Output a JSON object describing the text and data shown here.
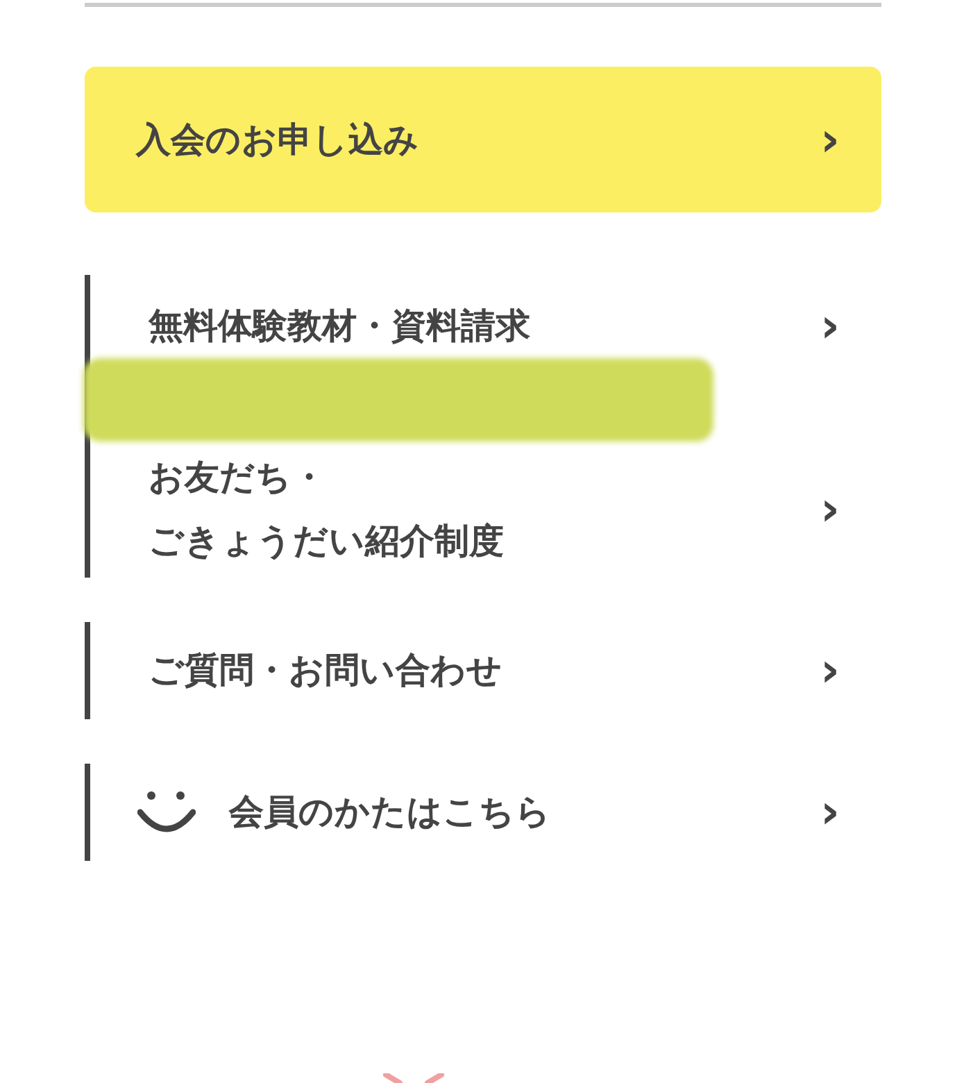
{
  "apply_button": {
    "label": "入会のお申し込み",
    "arrow": "›"
  },
  "menu_groups": [
    {
      "items": [
        {
          "lines": [
            "無料体験教材・資料請求"
          ],
          "arrow": "›",
          "kind": "text"
        },
        {
          "lines": [
            "お友だち・",
            "ごきょうだい紹介制度"
          ],
          "arrow": "›",
          "kind": "text"
        }
      ]
    },
    {
      "items": [
        {
          "lines": [
            "ご質問・お問い合わせ"
          ],
          "arrow": "›",
          "kind": "text"
        }
      ]
    },
    {
      "items": [
        {
          "lines": [
            "会員のかたはこちら"
          ],
          "arrow": "›",
          "kind": "smile"
        }
      ]
    }
  ]
}
